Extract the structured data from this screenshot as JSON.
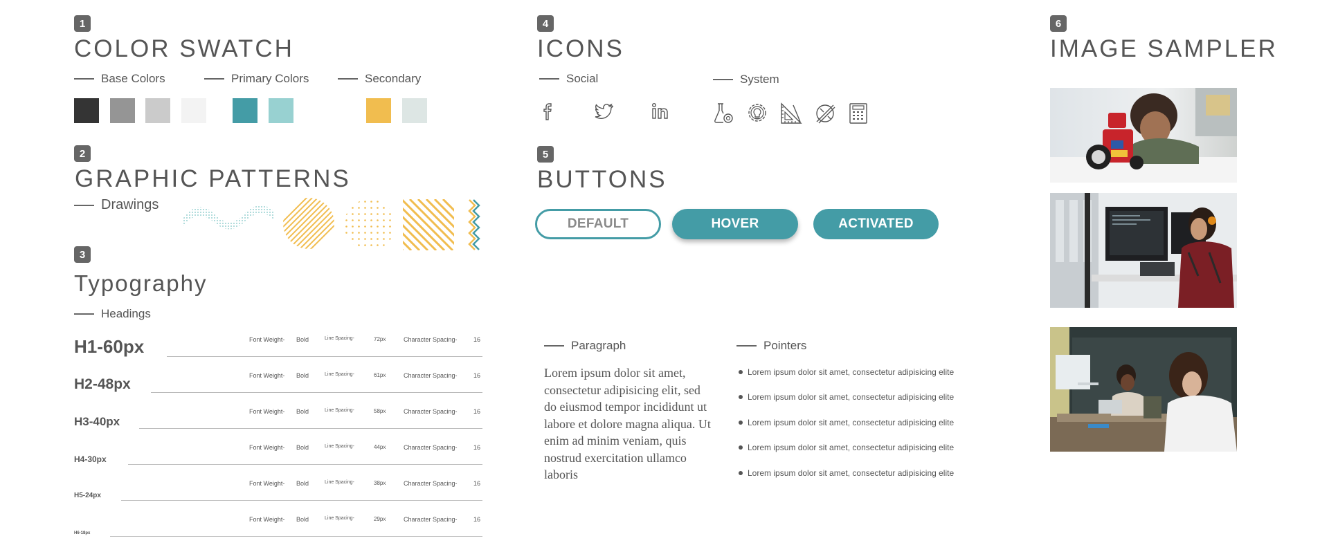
{
  "colors": {
    "teal": "#449ca6",
    "teal_light": "#98d1d1",
    "yellow": "#f1bd4f",
    "text": "#555555"
  },
  "section1": {
    "number": "1",
    "title": "COLOR SWATCH",
    "groups": [
      {
        "label": "Base Colors",
        "swatches": [
          "#343434",
          "#959595",
          "#cbcbcb",
          "#f3f3f3"
        ]
      },
      {
        "label": "Primary Colors",
        "swatches": [
          "#449ca6",
          "#98d1d1"
        ]
      },
      {
        "label": "Secondary",
        "swatches": [
          "#f1bd4f",
          "#dde6e4"
        ]
      }
    ]
  },
  "section2": {
    "number": "2",
    "title": "GRAPHIC PATTERNS",
    "drawings_label": "Drawings"
  },
  "section3": {
    "number": "3",
    "title": "Typography",
    "headings_label": "Headings",
    "labels": {
      "font_weight": "Font Weight-",
      "bold": "Bold",
      "line_spacing": "Line Spacing-",
      "char_spacing": "Character Spacing-"
    },
    "rows": [
      {
        "name": "H1-60px",
        "line": "72px",
        "char": "16"
      },
      {
        "name": "H2-48px",
        "line": "61px",
        "char": "16"
      },
      {
        "name": "H3-40px",
        "line": "58px",
        "char": "16"
      },
      {
        "name": "H4-30px",
        "line": "44px",
        "char": "16"
      },
      {
        "name": "H5-24px",
        "line": "38px",
        "char": "16"
      },
      {
        "name": "H6-18px",
        "line": "29px",
        "char": "16"
      }
    ]
  },
  "section4": {
    "number": "4",
    "title": "ICONS",
    "social_label": "Social",
    "system_label": "System",
    "social_icons": [
      "facebook-icon",
      "twitter-icon",
      "linkedin-icon"
    ],
    "system_icons": [
      "flask-gear-icon",
      "lightbulb-gear-icon",
      "ruler-triangle-icon",
      "design-tools-icon",
      "calculator-icon"
    ]
  },
  "section5": {
    "number": "5",
    "title": "BUTTONS",
    "default_label": "DEFAULT",
    "hover_label": "HOVER",
    "activated_label": "ACTIVATED"
  },
  "paragraph": {
    "label": "Paragraph",
    "text": "Lorem ipsum dolor sit amet, consectetur adipisicing elit, sed do eiusmod tempor incididunt ut labore et dolore magna aliqua. Ut enim ad minim veniam, quis nostrud exercitation ullamco laboris"
  },
  "pointers": {
    "label": "Pointers",
    "items": [
      "Lorem ipsum dolor sit amet, consectetur adipisicing elite",
      "Lorem ipsum dolor sit amet, consectetur adipisicing elite",
      "Lorem ipsum dolor sit amet, consectetur adipisicing elite",
      "Lorem ipsum dolor sit amet, consectetur adipisicing elite",
      "Lorem ipsum dolor sit amet, consectetur adipisicing elite"
    ]
  },
  "section6": {
    "number": "6",
    "title": "IMAGE SAMPLER"
  }
}
